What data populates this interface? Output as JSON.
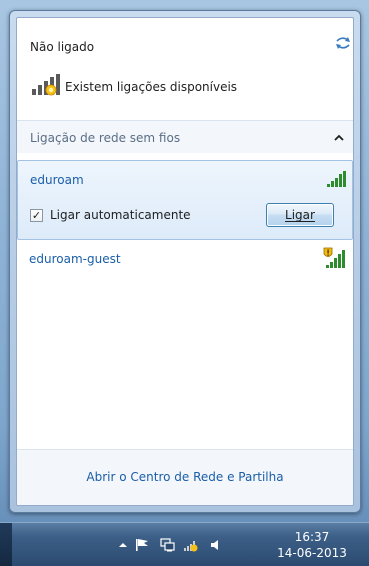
{
  "flyout": {
    "status": "Não ligado",
    "available_text": "Existem ligações disponíveis",
    "section_label": "Ligação de rede sem fios",
    "networks": [
      {
        "name": "eduroam",
        "secured": false,
        "signal_bars": 5
      },
      {
        "name": "eduroam-guest",
        "secured": false,
        "warning": true,
        "signal_bars": 5
      }
    ],
    "auto_connect_label": "Ligar automaticamente",
    "auto_connect_checked": true,
    "connect_button_label": "Ligar",
    "footer_link": "Abrir o Centro de Rede e Partilha"
  },
  "taskbar": {
    "time": "16:37",
    "date": "14-06-2013"
  },
  "colors": {
    "link": "#1a5ea8",
    "signal_green": "#2e8b2e",
    "warning_yellow": "#f2b90f"
  }
}
